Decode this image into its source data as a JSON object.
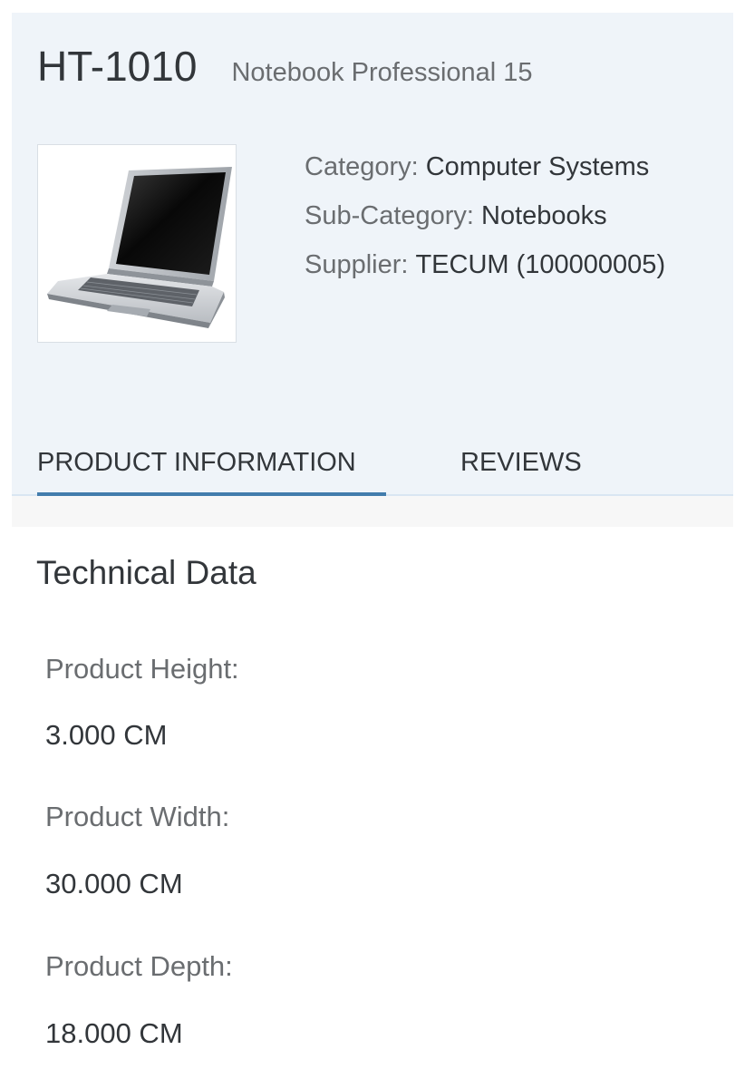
{
  "header": {
    "title": "HT-1010",
    "subtitle": "Notebook Professional 15",
    "image": {
      "icon": "laptop-icon"
    },
    "attributes": [
      {
        "label": "Category:",
        "value": "Computer Systems"
      },
      {
        "label": "Sub-Category:",
        "value": "Notebooks"
      },
      {
        "label": "Supplier:",
        "value": "TECUM (100000005)"
      }
    ]
  },
  "tabs": [
    {
      "label": "PRODUCT INFORMATION",
      "selected": true
    },
    {
      "label": "REVIEWS",
      "selected": false
    }
  ],
  "technical_data": {
    "title": "Technical Data",
    "fields": [
      {
        "label": "Product Height:",
        "value": "3.000 CM"
      },
      {
        "label": "Product Width:",
        "value": "30.000 CM"
      },
      {
        "label": "Product Depth:",
        "value": "18.000 CM"
      }
    ]
  },
  "colors": {
    "header_background": "#eff4f9",
    "tab_accent": "#427cac"
  }
}
